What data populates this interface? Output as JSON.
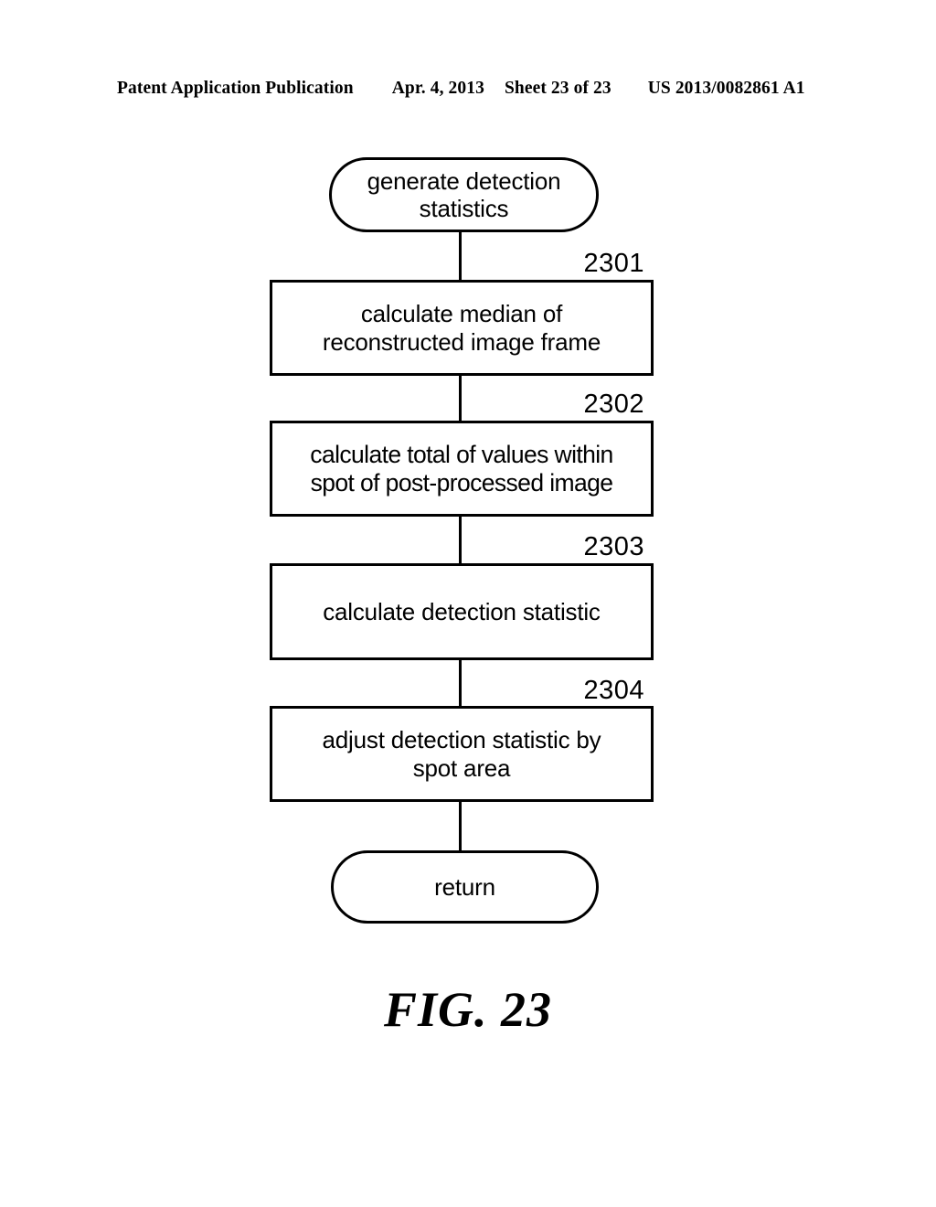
{
  "header": {
    "publication": "Patent Application Publication",
    "date": "Apr. 4, 2013",
    "sheet": "Sheet 23 of 23",
    "patent_number": "US 2013/0082861 A1"
  },
  "figure": {
    "caption": "FIG. 23",
    "type": "flowchart",
    "start_terminal": {
      "label": "generate detection statistics",
      "line1": "generate detection",
      "line2": "statistics",
      "shape": "stadium"
    },
    "steps": [
      {
        "ref": "2301",
        "label": "calculate median of reconstructed image frame",
        "line1": "calculate median of",
        "line2": "reconstructed image frame",
        "shape": "rectangle"
      },
      {
        "ref": "2302",
        "label": "calculate total of values within spot of post-processed image",
        "line1": "calculate total of values within",
        "line2": "spot of post-processed image",
        "shape": "rectangle"
      },
      {
        "ref": "2303",
        "label": "calculate detection statistic",
        "line1": "calculate detection statistic",
        "line2": "",
        "shape": "rectangle"
      },
      {
        "ref": "2304",
        "label": "adjust detection statistic by spot area",
        "line1": "adjust detection statistic by",
        "line2": "spot area",
        "shape": "rectangle"
      }
    ],
    "end_terminal": {
      "label": "return",
      "shape": "stadium"
    }
  },
  "colors": {
    "ink": "#000000",
    "paper": "#ffffff"
  }
}
